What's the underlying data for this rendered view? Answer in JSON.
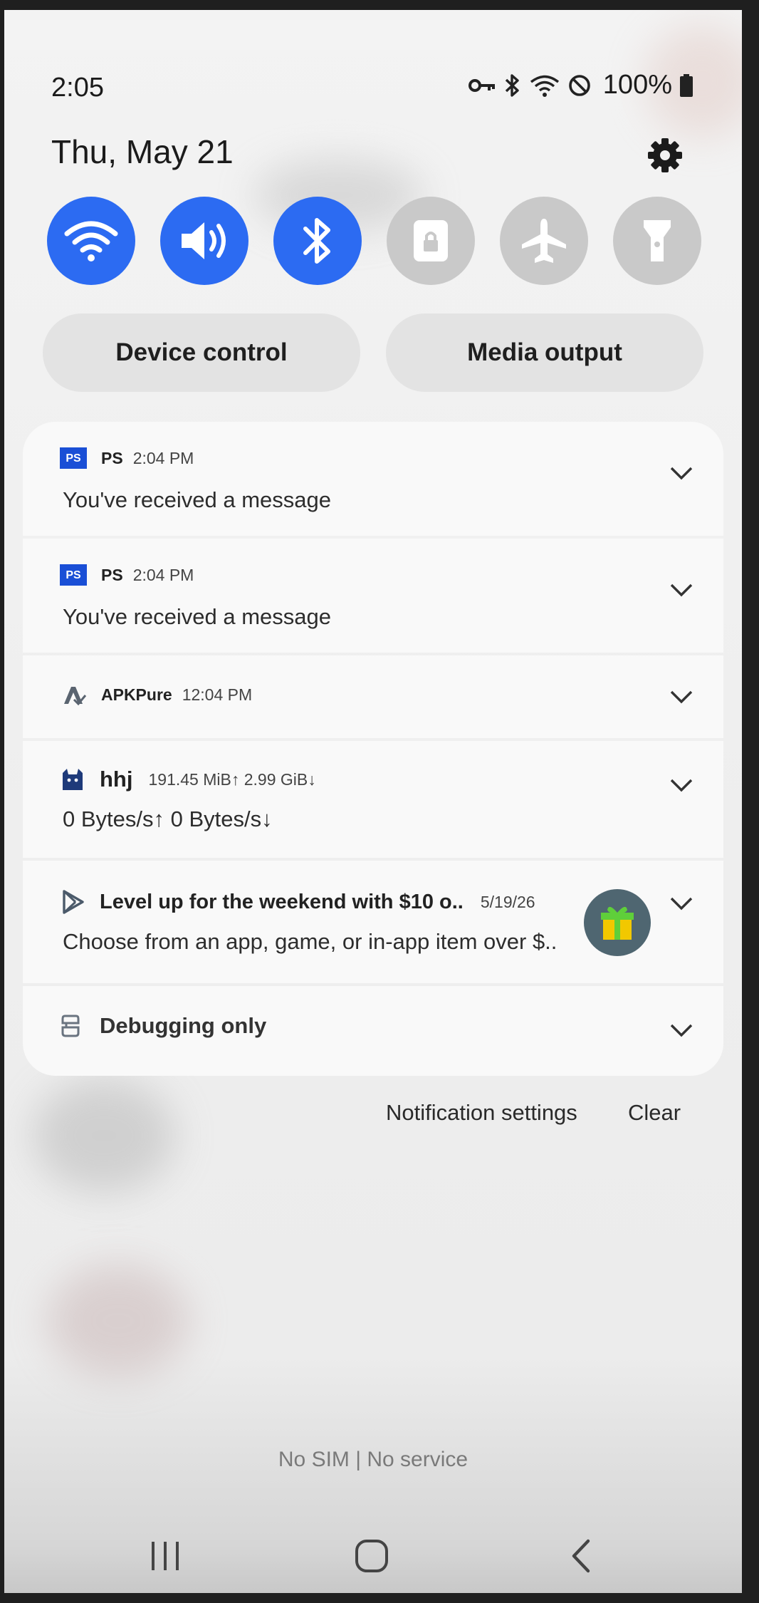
{
  "status_bar": {
    "time": "2:05",
    "battery": "100%",
    "icons": [
      "vpn-key-icon",
      "bluetooth-icon",
      "wifi-icon",
      "do-not-disturb-icon",
      "battery-icon"
    ]
  },
  "header": {
    "date": "Thu, May 21",
    "settings_icon": "gear-icon"
  },
  "quick_settings": [
    {
      "name": "wifi",
      "icon": "wifi-icon",
      "active": true
    },
    {
      "name": "sound",
      "icon": "speaker-icon",
      "active": true
    },
    {
      "name": "bluetooth",
      "icon": "bluetooth-icon",
      "active": true
    },
    {
      "name": "rotation-lock",
      "icon": "lock-icon",
      "active": false
    },
    {
      "name": "airplane",
      "icon": "airplane-icon",
      "active": false
    },
    {
      "name": "flashlight",
      "icon": "flashlight-icon",
      "active": false
    }
  ],
  "buttons": {
    "device_control": "Device control",
    "media_output": "Media output"
  },
  "notifications": [
    {
      "app": "PS",
      "time": "2:04 PM",
      "message": "You've received a message"
    },
    {
      "app": "PS",
      "time": "2:04 PM",
      "message": "You've received a message"
    },
    {
      "app": "APKPure",
      "time": "12:04 PM"
    },
    {
      "app": "hhj",
      "time": "191.45 MiB↑ 2.99 GiB↓",
      "message": "0 Bytes/s↑ 0 Bytes/s↓"
    },
    {
      "app": "Level up for the weekend with $10 o..",
      "time": "5/19/26",
      "message": "Choose from an app, game, or in-app item over $.."
    },
    {
      "app": "Debugging only"
    }
  ],
  "footer": {
    "notification_settings": "Notification settings",
    "clear": "Clear",
    "network_status": "No SIM | No service"
  },
  "colors": {
    "accent": "#2c6bf2",
    "inactive_toggle": "#c9c9c9",
    "panel": "#f9f9f9"
  }
}
